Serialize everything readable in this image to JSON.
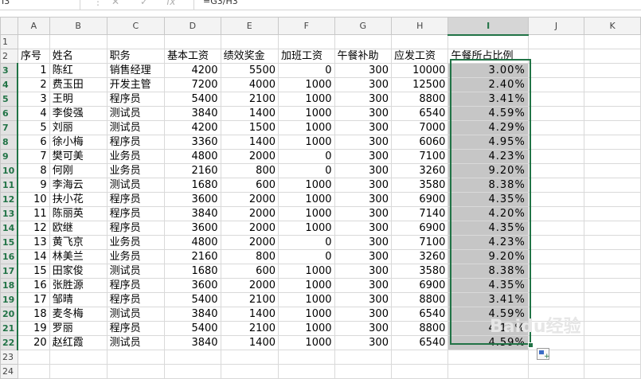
{
  "formula_bar": {
    "namebox": "I3",
    "cancel": "✕",
    "confirm": "✓",
    "fx": "fx",
    "formula": "=G3/H3"
  },
  "columns": [
    "A",
    "B",
    "C",
    "D",
    "E",
    "F",
    "G",
    "H",
    "I",
    "J",
    "K"
  ],
  "header_row": [
    "序号",
    "姓名",
    "职务",
    "基本工资",
    "绩效奖金",
    "加班工资",
    "午餐补助",
    "应发工资",
    "午餐所占比例"
  ],
  "rows": [
    [
      "1",
      "陈红",
      "销售经理",
      "4200",
      "5500",
      "0",
      "300",
      "10000",
      "3.00%"
    ],
    [
      "2",
      "费玉田",
      "开发主管",
      "7200",
      "4000",
      "1000",
      "300",
      "12500",
      "2.40%"
    ],
    [
      "3",
      "王明",
      "程序员",
      "5400",
      "2100",
      "1000",
      "300",
      "8800",
      "3.41%"
    ],
    [
      "4",
      "李俊强",
      "测试员",
      "3840",
      "1400",
      "1000",
      "300",
      "6540",
      "4.59%"
    ],
    [
      "5",
      "刘丽",
      "测试员",
      "4200",
      "1500",
      "1000",
      "300",
      "7000",
      "4.29%"
    ],
    [
      "6",
      "徐小梅",
      "程序员",
      "3360",
      "1400",
      "1000",
      "300",
      "6060",
      "4.95%"
    ],
    [
      "7",
      "樊可美",
      "业务员",
      "4800",
      "2000",
      "0",
      "300",
      "7100",
      "4.23%"
    ],
    [
      "8",
      "何刚",
      "业务员",
      "2160",
      "800",
      "0",
      "300",
      "3260",
      "9.20%"
    ],
    [
      "9",
      "李海云",
      "测试员",
      "1680",
      "600",
      "1000",
      "300",
      "3580",
      "8.38%"
    ],
    [
      "10",
      "扶小花",
      "程序员",
      "3600",
      "2000",
      "1000",
      "300",
      "6900",
      "4.35%"
    ],
    [
      "11",
      "陈丽英",
      "程序员",
      "3840",
      "2000",
      "1000",
      "300",
      "7140",
      "4.20%"
    ],
    [
      "12",
      "欧继",
      "程序员",
      "3600",
      "2000",
      "1000",
      "300",
      "6900",
      "4.35%"
    ],
    [
      "13",
      "黄飞京",
      "业务员",
      "4800",
      "2000",
      "0",
      "300",
      "7100",
      "4.23%"
    ],
    [
      "14",
      "林美兰",
      "业务员",
      "2160",
      "800",
      "0",
      "300",
      "3260",
      "9.20%"
    ],
    [
      "15",
      "田家俊",
      "测试员",
      "1680",
      "600",
      "1000",
      "300",
      "3580",
      "8.38%"
    ],
    [
      "16",
      "张胜源",
      "程序员",
      "3600",
      "2000",
      "1000",
      "300",
      "6900",
      "4.35%"
    ],
    [
      "17",
      "邹晴",
      "程序员",
      "5400",
      "2100",
      "1000",
      "300",
      "8800",
      "3.41%"
    ],
    [
      "18",
      "麦冬梅",
      "测试员",
      "3840",
      "1400",
      "1000",
      "300",
      "6540",
      "4.59%"
    ],
    [
      "19",
      "罗丽",
      "程序员",
      "5400",
      "2100",
      "1000",
      "300",
      "8800",
      "4.11%"
    ],
    [
      "20",
      "赵红霞",
      "测试员",
      "3840",
      "1400",
      "1000",
      "300",
      "6540",
      "4.59%"
    ]
  ],
  "row_numbers": [
    "1",
    "2",
    "3",
    "4",
    "5",
    "6",
    "7",
    "8",
    "9",
    "10",
    "11",
    "12",
    "13",
    "14",
    "15",
    "16",
    "17",
    "18",
    "19",
    "20",
    "21",
    "22",
    "23",
    "24"
  ],
  "watermark": "Baidu经验",
  "colors": {
    "accent": "#217346",
    "selection_fill": "#c6c6c6",
    "header_bg": "#f3f3f3"
  }
}
